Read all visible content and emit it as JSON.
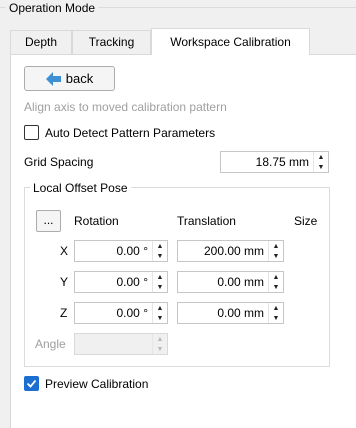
{
  "group": {
    "title": "Operation Mode"
  },
  "tabs": [
    {
      "label": "Depth"
    },
    {
      "label": "Tracking"
    },
    {
      "label": "Workspace Calibration"
    }
  ],
  "back_button": {
    "label": "back"
  },
  "hint": "Align axis to moved calibration pattern",
  "auto_detect": {
    "label": "Auto Detect Pattern Parameters",
    "checked": false
  },
  "grid_spacing": {
    "label": "Grid Spacing",
    "value": "18.75 mm"
  },
  "pose": {
    "title": "Local Offset Pose",
    "dots_label": "...",
    "headers": {
      "rotation": "Rotation",
      "translation": "Translation",
      "size": "Size"
    },
    "rows": [
      {
        "axis": "X",
        "rotation": "0.00 °",
        "translation": "200.00 mm"
      },
      {
        "axis": "Y",
        "rotation": "0.00 °",
        "translation": "0.00 mm"
      },
      {
        "axis": "Z",
        "rotation": "0.00 °",
        "translation": "0.00 mm"
      }
    ],
    "angle": {
      "label": "Angle",
      "value": ""
    }
  },
  "preview": {
    "label": "Preview Calibration",
    "checked": true
  },
  "colors": {
    "accent": "#1a6fd1",
    "back_arrow": "#3d8fd6",
    "disabled_text": "#a0a0a0"
  },
  "icons": {
    "back": "back-arrow-icon",
    "spin_up": "triangle-up",
    "spin_down": "triangle-down",
    "check": "checkmark-icon"
  }
}
